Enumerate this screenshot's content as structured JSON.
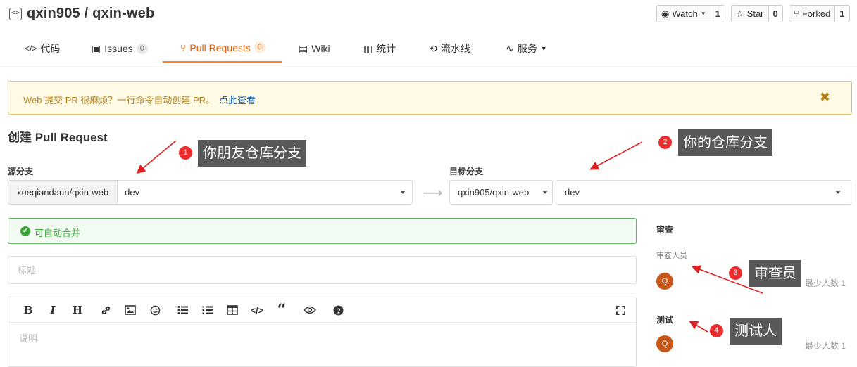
{
  "header": {
    "repo_title": "qxin905 / qxin-web",
    "repo_icon": "code-icon",
    "watch": {
      "label": "Watch",
      "count": "1"
    },
    "star": {
      "label": "Star",
      "count": "0"
    },
    "forked": {
      "label": "Forked",
      "count": "1"
    }
  },
  "tabs": [
    {
      "label": "代码",
      "icon": "code-icon"
    },
    {
      "label": "Issues",
      "badge": "0",
      "icon": "issues-icon"
    },
    {
      "label": "Pull Requests",
      "badge": "0",
      "icon": "pull-request-icon"
    },
    {
      "label": "Wiki",
      "icon": "book-icon"
    },
    {
      "label": "统计",
      "icon": "bar-chart-icon"
    },
    {
      "label": "流水线",
      "icon": "pipeline-icon"
    },
    {
      "label": "服务",
      "icon": "pulse-icon"
    }
  ],
  "notice": {
    "text": "Web 提交 PR 很麻烦？一行命令自动创建 PR。",
    "link": "点此查看",
    "close_icon": "close-icon"
  },
  "page_title": "创建 Pull Request",
  "source": {
    "label": "源分支",
    "repo": "xueqiandaun/qxin-web",
    "branch": "dev"
  },
  "target": {
    "label": "目标分支",
    "repo": "qxin905/qxin-web",
    "branch": "dev"
  },
  "merge_status": "可自动合并",
  "title_placeholder": "标题",
  "description_placeholder": "说明",
  "toolbar_icons": [
    "bold-icon",
    "italic-icon",
    "heading-icon",
    "link-icon",
    "image-icon",
    "emoji-icon",
    "bullet-list-icon",
    "numbered-list-icon",
    "table-icon",
    "code-icon",
    "quote-icon",
    "preview-icon",
    "help-icon",
    "fullscreen-icon"
  ],
  "sidebar": {
    "review_heading": "审查",
    "reviewers_label": "审查人员",
    "reviewer_avatar": "Q",
    "reviewer_min": "最少人数 1",
    "test_heading": "测试",
    "tester_avatar": "Q",
    "tester_min": "最少人数 1"
  },
  "annotations": [
    {
      "num": "1",
      "text": "你朋友仓库分支"
    },
    {
      "num": "2",
      "text": "你的仓库分支"
    },
    {
      "num": "3",
      "text": "审查员"
    },
    {
      "num": "4",
      "text": "测试人"
    }
  ],
  "colors": {
    "accent": "#e05f0b",
    "success": "#3ca63c",
    "annotation": "#ec2c2c",
    "notice_bg": "#fffbe6"
  }
}
